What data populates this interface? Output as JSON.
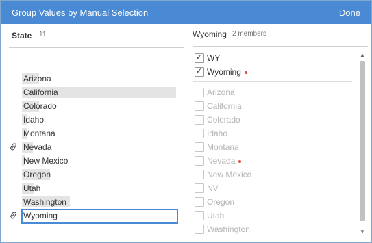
{
  "dialog": {
    "title": "Group Values by Manual Selection",
    "done_label": "Done"
  },
  "left": {
    "header": "State",
    "count": "11",
    "states": [
      {
        "label": "Arizona",
        "bar": 0.11,
        "clip": false,
        "selected": false
      },
      {
        "label": "California",
        "bar": 1.0,
        "clip": false,
        "selected": false
      },
      {
        "label": "Colorado",
        "bar": 0.11,
        "clip": false,
        "selected": false
      },
      {
        "label": "Idaho",
        "bar": 0.03,
        "clip": false,
        "selected": false
      },
      {
        "label": "Montana",
        "bar": 0.03,
        "clip": false,
        "selected": false
      },
      {
        "label": "Nevada",
        "bar": 0.07,
        "clip": true,
        "selected": false
      },
      {
        "label": "New Mexico",
        "bar": 0.02,
        "clip": false,
        "selected": false
      },
      {
        "label": "Oregon",
        "bar": 0.18,
        "clip": false,
        "selected": false
      },
      {
        "label": "Utah",
        "bar": 0.08,
        "clip": false,
        "selected": false
      },
      {
        "label": "Washington",
        "bar": 0.31,
        "clip": false,
        "selected": false
      },
      {
        "label": "Wyoming",
        "bar": 0.02,
        "clip": true,
        "selected": true
      }
    ]
  },
  "right": {
    "group_title": "Wyoming",
    "group_count": "2 members",
    "members": [
      {
        "label": "WY",
        "checked": true,
        "disabled": false,
        "dot": false
      },
      {
        "label": "Wyoming",
        "checked": true,
        "disabled": false,
        "dot": true
      },
      {
        "label": "Arizona",
        "checked": false,
        "disabled": true,
        "dot": false
      },
      {
        "label": "California",
        "checked": false,
        "disabled": true,
        "dot": false
      },
      {
        "label": "Colorado",
        "checked": false,
        "disabled": true,
        "dot": false
      },
      {
        "label": "Idaho",
        "checked": false,
        "disabled": true,
        "dot": false
      },
      {
        "label": "Montana",
        "checked": false,
        "disabled": true,
        "dot": false
      },
      {
        "label": "Nevada",
        "checked": false,
        "disabled": true,
        "dot": true
      },
      {
        "label": "New Mexico",
        "checked": false,
        "disabled": true,
        "dot": false
      },
      {
        "label": "NV",
        "checked": false,
        "disabled": true,
        "dot": false
      },
      {
        "label": "Oregon",
        "checked": false,
        "disabled": true,
        "dot": false
      },
      {
        "label": "Utah",
        "checked": false,
        "disabled": true,
        "dot": false
      },
      {
        "label": "Washington",
        "checked": false,
        "disabled": true,
        "dot": false
      }
    ]
  },
  "colors": {
    "titlebar": "#4a8ad4",
    "selection_border": "#4a8ad4",
    "bar": "#e4e4e4",
    "dot": "#e04a4a"
  },
  "icons": {
    "clip": "paperclip-icon",
    "check": "checkmark-icon",
    "scroll_up": "scroll-up-arrow-icon",
    "scroll_down": "scroll-down-arrow-icon"
  }
}
